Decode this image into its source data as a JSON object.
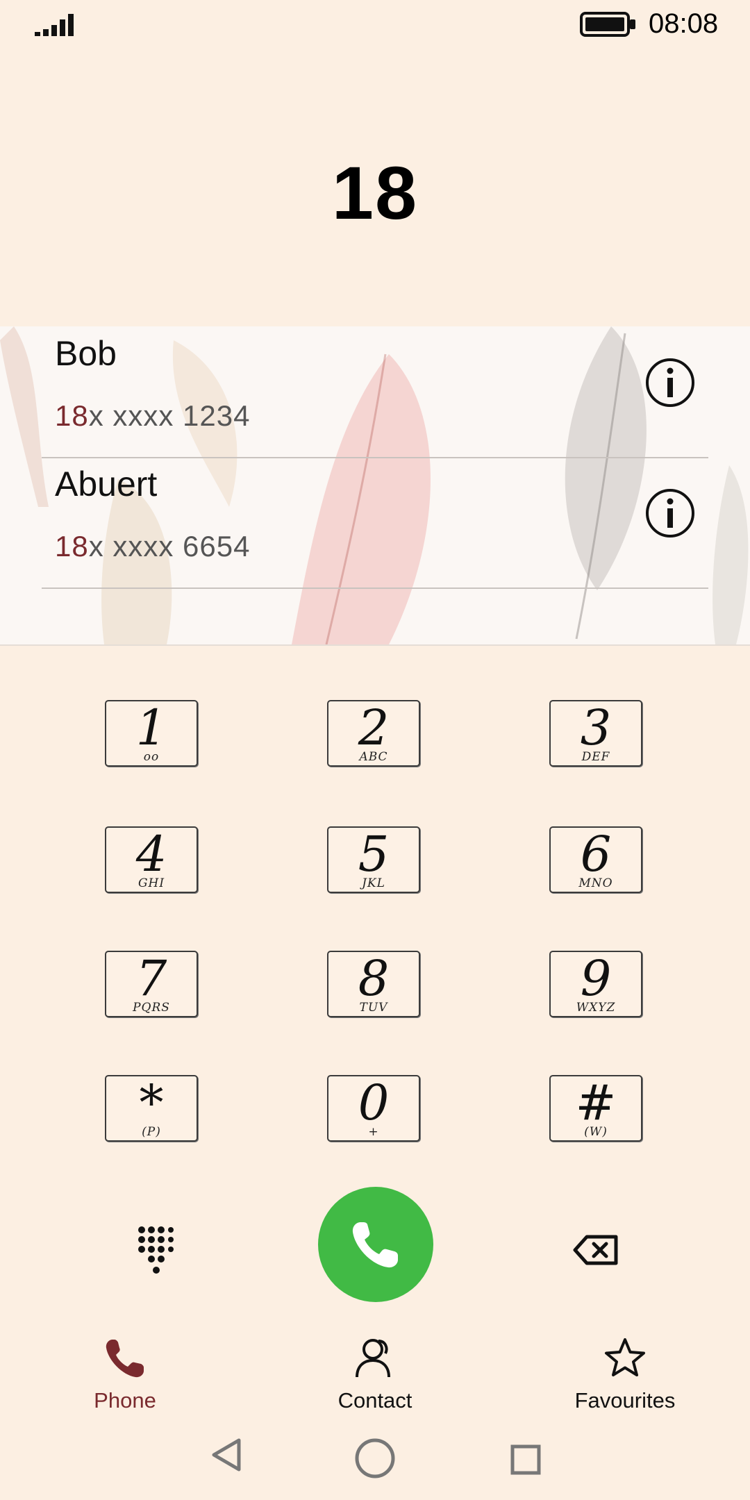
{
  "status_bar": {
    "time": "08:08"
  },
  "dialer": {
    "dialed_number": "18"
  },
  "matches": [
    {
      "name": "Bob",
      "match": "18",
      "rest": "x xxxx 1234"
    },
    {
      "name": "Abuert",
      "match": "18",
      "rest": "x xxxx 6654"
    }
  ],
  "keypad": [
    {
      "digit": "1",
      "letters": "oo"
    },
    {
      "digit": "2",
      "letters": "ABC"
    },
    {
      "digit": "3",
      "letters": "DEF"
    },
    {
      "digit": "4",
      "letters": "GHI"
    },
    {
      "digit": "5",
      "letters": "JKL"
    },
    {
      "digit": "6",
      "letters": "MNO"
    },
    {
      "digit": "7",
      "letters": "PQRS"
    },
    {
      "digit": "8",
      "letters": "TUV"
    },
    {
      "digit": "9",
      "letters": "WXYZ"
    },
    {
      "digit": "*",
      "letters": "(P)"
    },
    {
      "digit": "0",
      "letters": "+"
    },
    {
      "digit": "#",
      "letters": "(W)"
    }
  ],
  "tabs": [
    {
      "label": "Phone",
      "icon": "phone-icon",
      "active": true
    },
    {
      "label": "Contact",
      "icon": "contacts-icon",
      "active": false
    },
    {
      "label": "Favourites",
      "icon": "star-icon",
      "active": false
    }
  ],
  "colors": {
    "accent": "#7a2a2e",
    "call": "#41ba45",
    "background": "#fcefe2"
  }
}
